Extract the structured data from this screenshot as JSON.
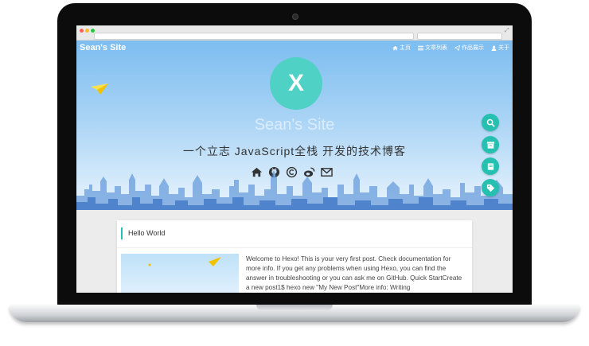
{
  "site": {
    "brand": "Sean's Site",
    "nav": [
      {
        "label": "主页",
        "icon": "home-icon"
      },
      {
        "label": "文章列表",
        "icon": "list-icon"
      },
      {
        "label": "作品展示",
        "icon": "paper-plane-icon"
      },
      {
        "label": "关于",
        "icon": "user-icon"
      }
    ]
  },
  "hero": {
    "avatar_letter": "X",
    "title": "Sean's Site",
    "subtitle": "一个立志 JavaScript全栈 开发的技术博客",
    "social_icons": [
      "home-icon",
      "github-icon",
      "copyright-icon",
      "weibo-icon",
      "mail-icon"
    ]
  },
  "floating_buttons": [
    "search-icon",
    "archive-icon",
    "book-icon",
    "tags-icon"
  ],
  "post": {
    "title": "Hello World",
    "excerpt": "Welcome to Hexo! This is your very first post. Check documentation for more info. If you get any problems when using Hexo, you can find the answer in troubleshooting or you can ask me on GitHub. Quick StartCreate a new post1$ hexo new \"My New Post\"More info: Writing"
  },
  "colors": {
    "accent": "#26c0b0",
    "avatar": "#4fd1c5",
    "sky_top": "#7dbdf0",
    "city": "#3f7fd0"
  }
}
